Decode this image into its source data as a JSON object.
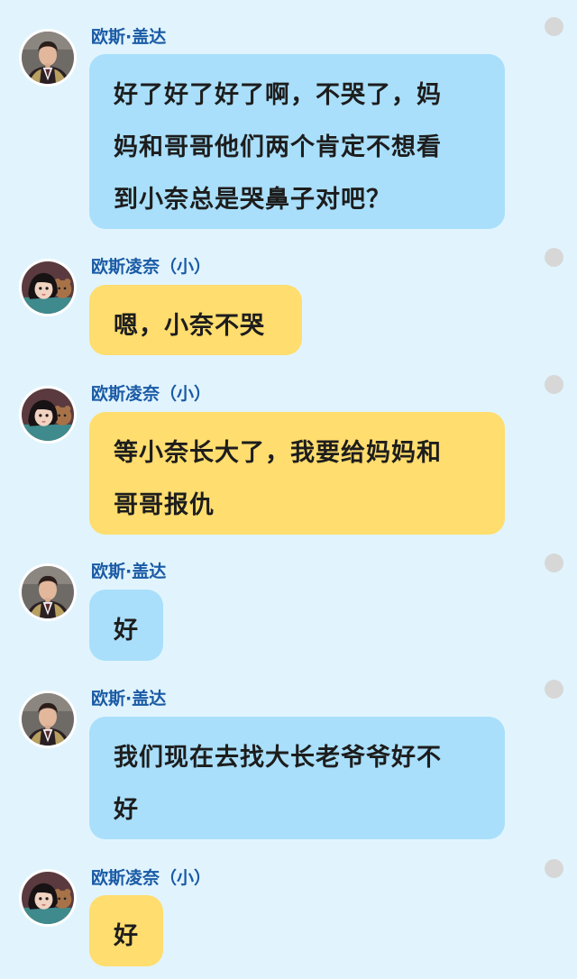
{
  "conversation": {
    "messages": [
      {
        "sender": "欧斯·盖达",
        "avatar": "man-avatar",
        "bubble_color": "#a9dffb",
        "lines": [
          "好了好了好了啊，不哭了，妈",
          "妈和哥哥他们两个肯定不想看",
          "到小奈总是哭鼻子对吧？"
        ]
      },
      {
        "sender": "欧斯凌奈（小）",
        "avatar": "girl-avatar",
        "bubble_color": "#ffdd6e",
        "lines": [
          "嗯，小奈不哭"
        ]
      },
      {
        "sender": "欧斯凌奈（小）",
        "avatar": "girl-avatar",
        "bubble_color": "#ffdd6e",
        "lines": [
          "等小奈长大了，我要给妈妈和",
          "哥哥报仇"
        ]
      },
      {
        "sender": "欧斯·盖达",
        "avatar": "man-avatar",
        "bubble_color": "#a9dffb",
        "lines": [
          "好"
        ]
      },
      {
        "sender": "欧斯·盖达",
        "avatar": "man-avatar",
        "bubble_color": "#a9dffb",
        "lines": [
          "我们现在去找大长老爷爷好不",
          "好"
        ]
      },
      {
        "sender": "欧斯凌奈（小）",
        "avatar": "girl-avatar",
        "bubble_color": "#ffdd6e",
        "lines": [
          "好"
        ]
      }
    ]
  },
  "colors": {
    "background": "#e1f4fd",
    "name_text": "#1a5aa5",
    "blue_bubble": "#a9dffb",
    "yellow_bubble": "#ffdd6e",
    "select_dot": "#d7d7d7"
  }
}
